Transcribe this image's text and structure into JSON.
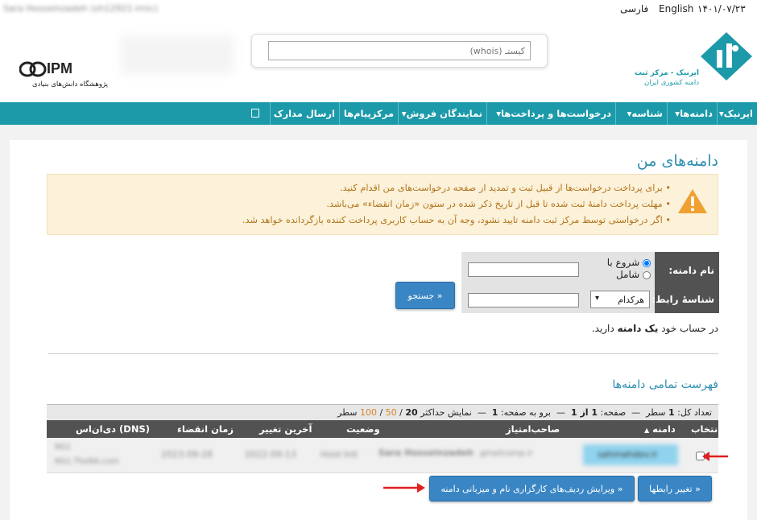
{
  "topbar": {
    "user_blurred": "Sara Hosseinzadeh (sh12921-irnic)",
    "lang_fa": "فارسی",
    "lang_en": "English",
    "date": "۱۴۰۱/۰۷/۲۳"
  },
  "header": {
    "search_placeholder": "کیستـ (whois)",
    "ipm_logo": "IPM",
    "ipm_caption": "پژوهشگاه دانش‌های بنیادی",
    "irnic_title": "ایرنیک - مرکز ثبت",
    "irnic_subtitle": "دامنه کشوری ایران",
    "blurred_banner": "████████"
  },
  "nav": [
    {
      "label": "ایرنیک",
      "dropdown": true
    },
    {
      "label": "دامنه‌ها",
      "dropdown": true
    },
    {
      "label": "شناسه",
      "dropdown": true
    },
    {
      "label": "درخواست‌ها و پرداخت‌ها",
      "dropdown": true
    },
    {
      "label": "نمایندگان فروش",
      "dropdown": true
    },
    {
      "label": "مرکزپیام‌ها",
      "dropdown": false
    },
    {
      "label": "ارسال مدارک",
      "dropdown": false
    }
  ],
  "page": {
    "title": "دامنه‌های من"
  },
  "notice": {
    "items": [
      "برای پرداخت درخواست‌ها از قبیل ثبت و تمدید از صفحه درخواست‌های من اقدام کنید.",
      "مهلت پرداخت دامنهٔ ثبت شده تا قبل از تاریخ ذکر شده در ستون «زمان انقضاء» می‌باشد.",
      "اگر درخواستی توسط مرکز ثبت دامنه تایید نشود، وجه آن به حساب کاربری پرداخت کننده بازگردانده خواهد شد."
    ]
  },
  "search": {
    "domain_label": "نام دامنه:",
    "option_starts": "شروع با",
    "option_contains": "شامل",
    "contact_label": "شناسهٔ رابط:",
    "contact_select": "هرکدام",
    "search_button": "جستجو »"
  },
  "account_text": {
    "prefix": "در حساب خود",
    "bold": "یک دامنه",
    "suffix": "دارید."
  },
  "list": {
    "title": "فهرست تمامی دامنه‌ها",
    "pager": {
      "total_prefix": "تعداد کل:",
      "total": "1",
      "total_suffix": "سطر",
      "page_prefix": "صفحه:",
      "page": "1 از 1",
      "goto_prefix": "برو به صفحه:",
      "goto": "1",
      "show_prefix": "نمایش حداکثر",
      "size_20": "20",
      "size_50": "50",
      "size_100": "100",
      "show_suffix": "سطر"
    },
    "columns": [
      "انتخاب",
      "دامنه",
      "صاحب‌امتیاز",
      "وضعیت",
      "آخرین تغییر",
      "زمان انقضاء",
      "دی‌ان‌اس (DNS)"
    ],
    "row": {
      "domain": "sahmahdev.ir",
      "holder": "Sara Hosseinzadeh",
      "holder_sub": "gmailcomp.ir",
      "status": "Hold Init",
      "last_change": "2022-09-13",
      "expire": "2023-09-28",
      "dns1": "NS1",
      "dns2": "NS1.TheRA.com"
    }
  },
  "actions": {
    "change_contacts": "تغییر رابطها »",
    "edit_rows": "ویرایش ردیف‌های کارگزاری نام و میزبانی دامنه »"
  },
  "colors": {
    "nav": "#1c9aaa",
    "accent": "#d8832a",
    "title": "#2e8fb0",
    "button": "#3a86c5"
  }
}
